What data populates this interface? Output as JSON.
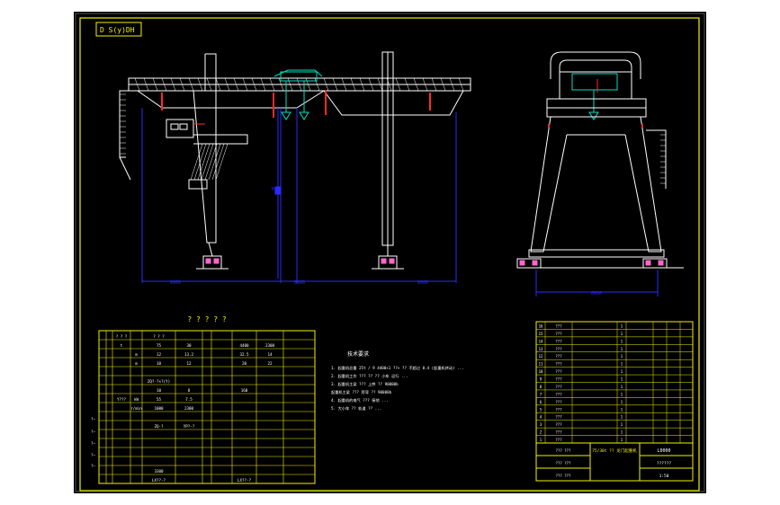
{
  "colors": {
    "background": "#000000",
    "frame": "#f2f200",
    "structure": "#ffffff",
    "dimension": "#2a2aff",
    "accent": "#ff2a2a",
    "hoist": "#00e0c0",
    "pink": "#ff66cc",
    "border_outer": "#ffffff"
  },
  "drawing": {
    "code": "D S(y)DH",
    "main_view": {
      "dim_labels": [
        "8000",
        "8000",
        "8000"
      ],
      "height_label": "H"
    },
    "side_view": {
      "dim_label": "6000"
    },
    "table_title": "? ? ? ? ?",
    "notes": {
      "title": "技术要求",
      "lines": [
        "1. 起重机总重 25t / 9 4400×1 ??× ?? 不超过 0.4 (起重机转动) ...",
        "2. 起重机工作 ??? ?? ?? 小车 运行 ...",
        "3. 起重机主梁 ??? 上拱 ?? 90000b",
        "   起重机主梁 ??? 旁弯 ?? 90000b",
        "4. 起重机的电气 ??? 接地 ...",
        "5. 大小车 ?? 轨道 ?? ..."
      ]
    },
    "param_table": {
      "rows": [
        [
          "",
          "",
          "? ? ?",
          "",
          "? ? ?",
          "",
          "",
          "",
          "",
          ""
        ],
        [
          "",
          "",
          "t",
          "",
          "75",
          "30",
          "",
          "",
          "4400",
          "2300"
        ],
        [
          "",
          "",
          "",
          "m",
          "12",
          "13.2",
          "",
          "",
          "32.5",
          "14"
        ],
        [
          "",
          "",
          "",
          "m",
          "10",
          "12",
          "",
          "",
          "20",
          "22"
        ],
        [
          "",
          "",
          "",
          "",
          "",
          "",
          "",
          "",
          "",
          ""
        ],
        [
          "",
          "",
          "",
          "",
          "ZQ?-?×?(Y)",
          "",
          "",
          "",
          "",
          ""
        ],
        [
          "",
          "",
          "",
          "",
          "10",
          "8",
          "",
          "",
          "160",
          ""
        ],
        [
          "",
          "",
          "Y???",
          "kW",
          "55",
          "7.5",
          "",
          "",
          "",
          ""
        ],
        [
          "",
          "",
          "",
          "r/min",
          "1000",
          "2300",
          "",
          "",
          "",
          ""
        ],
        [
          "",
          "",
          "",
          "",
          "",
          "",
          "",
          "",
          "",
          ""
        ],
        [
          "",
          "",
          "",
          "",
          "ZQ-?",
          "YP?-?",
          "",
          "",
          "",
          ""
        ],
        [
          "",
          "",
          "",
          "",
          "",
          "",
          "",
          "",
          "",
          ""
        ],
        [
          "",
          "",
          "",
          "",
          "",
          "",
          "",
          "",
          "",
          ""
        ],
        [
          "",
          "",
          "",
          "",
          "",
          "",
          "",
          "",
          "",
          ""
        ],
        [
          "",
          "",
          "",
          "",
          "",
          "",
          "",
          "",
          "",
          ""
        ],
        [
          "",
          "",
          "",
          "",
          "3300",
          "",
          "",
          "",
          "",
          ""
        ],
        [
          "",
          "",
          "",
          "",
          "LX??-?",
          "",
          "",
          "",
          "LX??-?",
          ""
        ]
      ]
    },
    "parts_list": {
      "rows": [
        [
          "16",
          "???",
          "",
          "1",
          "",
          "",
          "",
          ""
        ],
        [
          "15",
          "???",
          "",
          "1",
          "",
          "",
          "",
          ""
        ],
        [
          "14",
          "???",
          "",
          "1",
          "",
          "",
          "",
          ""
        ],
        [
          "13",
          "???",
          "",
          "1",
          "",
          "",
          "",
          ""
        ],
        [
          "12",
          "???",
          "",
          "1",
          "",
          "",
          "",
          ""
        ],
        [
          "11",
          "???",
          "",
          "1",
          "",
          "",
          "",
          ""
        ],
        [
          "10",
          "???",
          "",
          "1",
          "",
          "",
          "",
          ""
        ],
        [
          "9",
          "???",
          "",
          "1",
          "",
          "",
          "",
          ""
        ],
        [
          "8",
          "???",
          "",
          "1",
          "",
          "",
          "",
          ""
        ],
        [
          "7",
          "???",
          "",
          "1",
          "",
          "",
          "",
          ""
        ],
        [
          "6",
          "???",
          "",
          "1",
          "",
          "",
          "",
          ""
        ],
        [
          "5",
          "???",
          "",
          "1",
          "",
          "",
          "",
          ""
        ],
        [
          "4",
          "???",
          "",
          "1",
          "",
          "",
          "",
          ""
        ],
        [
          "3",
          "???",
          "",
          "1",
          "",
          "",
          "",
          ""
        ],
        [
          "2",
          "???",
          "",
          "1",
          "",
          "",
          "",
          ""
        ],
        [
          "1",
          "???",
          "",
          "1",
          "",
          "",
          "",
          ""
        ]
      ]
    },
    "title_block": {
      "drawing_no": "L0000",
      "title": "75/30t ?? 龙门起重机",
      "subtitle": "??????",
      "scale": "1:50"
    }
  }
}
